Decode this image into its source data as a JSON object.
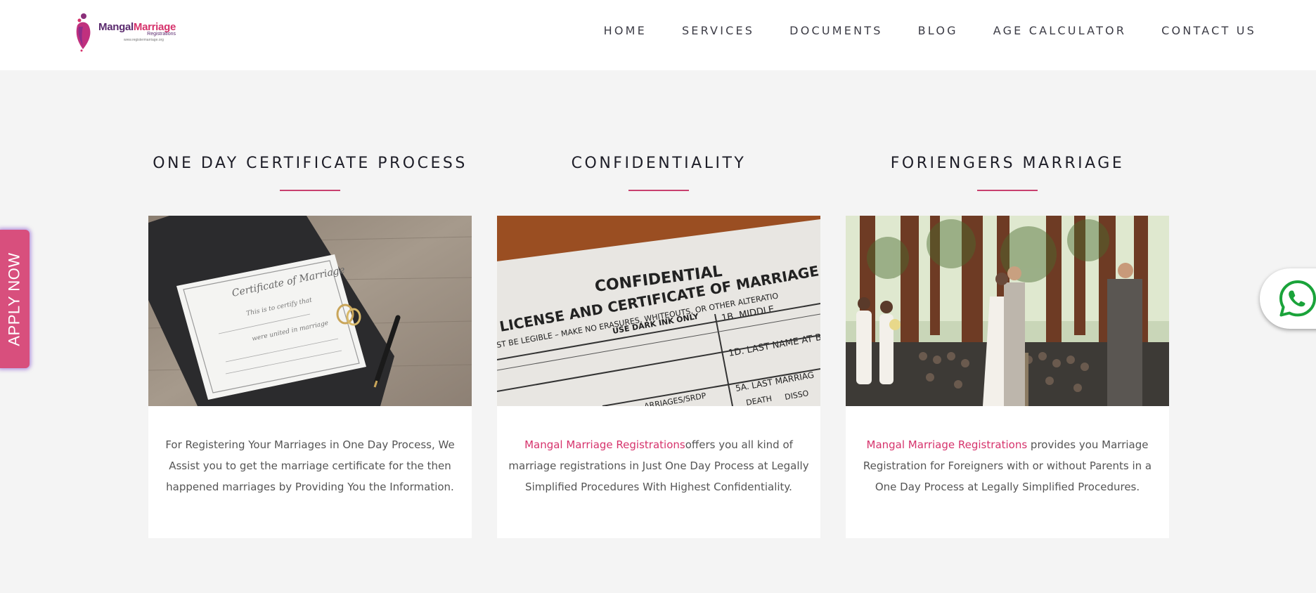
{
  "brand": {
    "name_part1": "Mangal",
    "name_part2": "Marriage",
    "tagline": "Registrations",
    "url": "www.registermarriage.org"
  },
  "nav": {
    "items": [
      "HOME",
      "SERVICES",
      "DOCUMENTS",
      "BLOG",
      "AGE CALCULATOR",
      "CONTACT US"
    ]
  },
  "features": [
    {
      "title": "ONE DAY CERTIFICATE PROCESS",
      "highlight": "",
      "text": "For Registering Your Marriages in One Day Process, We Assist you to get the marriage certificate for the then happened marriages by Providing You the Information.",
      "image": {
        "heading": "Certificate of Marriage",
        "line1": "This is to certify that",
        "line2": "were united in marriage"
      }
    },
    {
      "title": "CONFIDENTIALITY",
      "highlight": "Mangal Marriage Registrations",
      "text": "offers you all kind of marriage registrations in Just One Day Process at Legally Simplified Procedures With Highest Confidentiality.",
      "image": {
        "line1": "CONFIDENTIAL",
        "line2": "LICENSE AND CERTIFICATE OF MARRIAGE",
        "line3": "ST BE LEGIBLE – MAKE NO ERASURES, WHITEOUTS, OR OTHER ALTERATIO",
        "line4": "USE DARK INK ONLY",
        "field1": "1B. MIDDLE",
        "field2": "1D. LAST NAME AT B",
        "field3": "5A. LAST MARRIAG",
        "field4": "ARRIAGES/SRDP",
        "field5": "DEATH",
        "field6": "DISSO"
      }
    },
    {
      "title": "FORIENGERS MARRIAGE",
      "highlight": "Mangal Marriage Registrations",
      "text": " provides you Marriage Registration for Foreigners with or without Parents in a One Day Process at Legally Simplified Procedures."
    }
  ],
  "sidebar": {
    "apply_label": "APPLY NOW"
  },
  "colors": {
    "accent": "#d6336c",
    "apply_bg": "#d84f7d",
    "whatsapp": "#1aa33a"
  }
}
